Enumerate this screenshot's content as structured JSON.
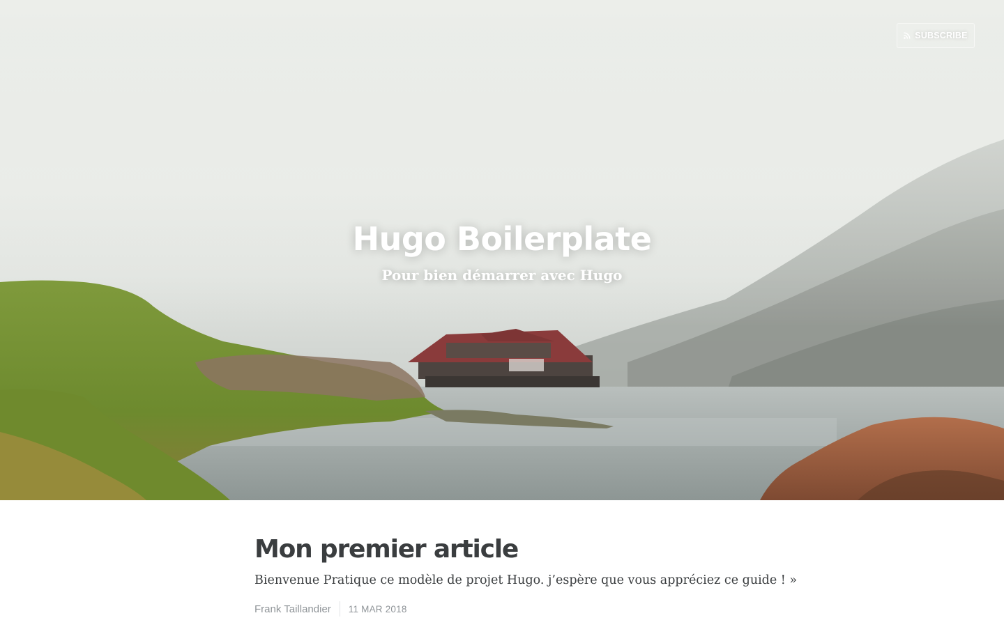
{
  "header": {
    "subscribe_label": "SUBSCRIBE",
    "subscribe_icon": "rss-icon",
    "site_title": "Hugo Boilerplate",
    "site_description": "Pour bien démarrer avec Hugo"
  },
  "posts": [
    {
      "title": "Mon premier article",
      "excerpt": "Bienvenue Pratique ce modèle de projet Hugo. j’espère que vous appréciez ce guide !",
      "read_more": "»",
      "author": "Frank Taillandier",
      "date": "11 MAR 2018"
    }
  ],
  "colors": {
    "text_dark": "#3a3d3f",
    "text_muted": "#8f9498",
    "hero_text": "#ffffff"
  }
}
